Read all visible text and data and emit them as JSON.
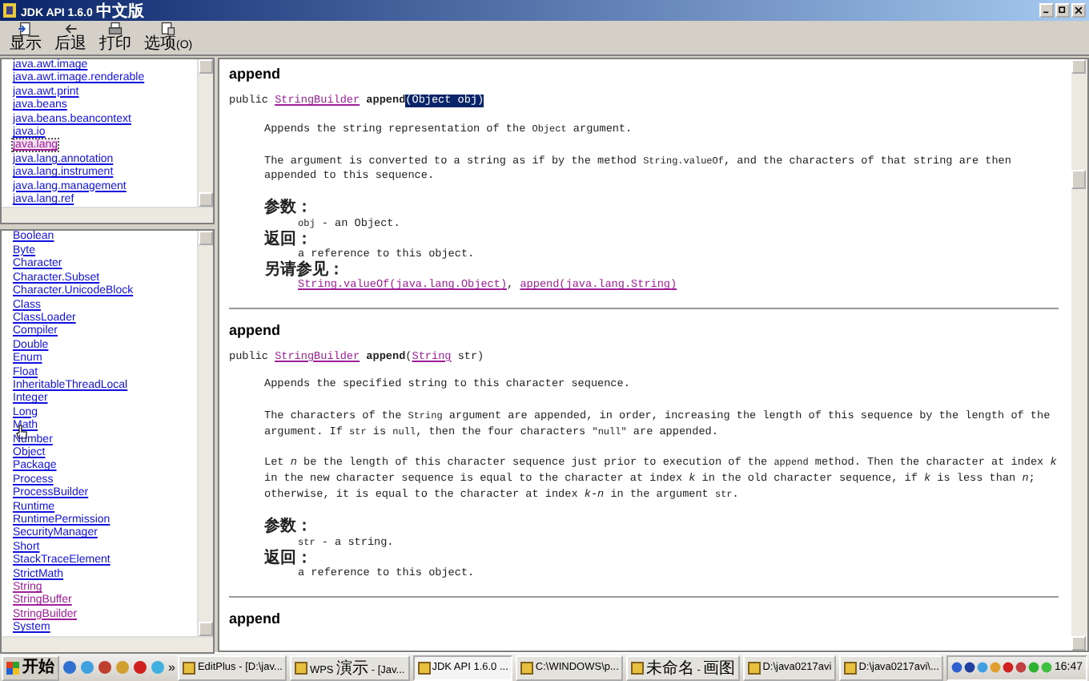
{
  "window": {
    "title": "JDK API 1.6.0 中文版"
  },
  "toolbar": [
    {
      "label": "显示"
    },
    {
      "label": "后退"
    },
    {
      "label": "打印"
    },
    {
      "label": "选项(O)"
    }
  ],
  "packages": [
    {
      "label": "java.awt.image",
      "selected": false,
      "visited": false
    },
    {
      "label": "java.awt.image.renderable",
      "selected": false,
      "visited": false
    },
    {
      "label": "java.awt.print",
      "selected": false,
      "visited": false
    },
    {
      "label": "java.beans",
      "selected": false,
      "visited": false
    },
    {
      "label": "java.beans.beancontext",
      "selected": false,
      "visited": false
    },
    {
      "label": "java.io",
      "selected": false,
      "visited": false
    },
    {
      "label": "java.lang",
      "selected": true,
      "visited": true
    },
    {
      "label": "java.lang.annotation",
      "selected": false,
      "visited": false
    },
    {
      "label": "java.lang.instrument",
      "selected": false,
      "visited": false
    },
    {
      "label": "java.lang.management",
      "selected": false,
      "visited": false
    },
    {
      "label": "java.lang.ref",
      "selected": false,
      "visited": false
    }
  ],
  "classes": [
    {
      "label": "Boolean",
      "visited": false,
      "hovered": false
    },
    {
      "label": "Byte",
      "visited": false,
      "hovered": false
    },
    {
      "label": "Character",
      "visited": false,
      "hovered": false
    },
    {
      "label": "Character.Subset",
      "visited": false,
      "hovered": false
    },
    {
      "label": "Character.UnicodeBlock",
      "visited": false,
      "hovered": false
    },
    {
      "label": "Class",
      "visited": false,
      "hovered": false
    },
    {
      "label": "ClassLoader",
      "visited": false,
      "hovered": false
    },
    {
      "label": "Compiler",
      "visited": false,
      "hovered": false
    },
    {
      "label": "Double",
      "visited": false,
      "hovered": false
    },
    {
      "label": "Enum",
      "visited": false,
      "hovered": false
    },
    {
      "label": "Float",
      "visited": false,
      "hovered": false
    },
    {
      "label": "InheritableThreadLocal",
      "visited": false,
      "hovered": false
    },
    {
      "label": "Integer",
      "visited": false,
      "hovered": false
    },
    {
      "label": "Long",
      "visited": false,
      "hovered": false
    },
    {
      "label": "Math",
      "visited": false,
      "hovered": true
    },
    {
      "label": "Number",
      "visited": false,
      "hovered": false
    },
    {
      "label": "Object",
      "visited": false,
      "hovered": false
    },
    {
      "label": "Package",
      "visited": false,
      "hovered": false
    },
    {
      "label": "Process",
      "visited": false,
      "hovered": false
    },
    {
      "label": "ProcessBuilder",
      "visited": false,
      "hovered": false
    },
    {
      "label": "Runtime",
      "visited": false,
      "hovered": false
    },
    {
      "label": "RuntimePermission",
      "visited": false,
      "hovered": false
    },
    {
      "label": "SecurityManager",
      "visited": false,
      "hovered": false
    },
    {
      "label": "Short",
      "visited": false,
      "hovered": false
    },
    {
      "label": "StackTraceElement",
      "visited": false,
      "hovered": false
    },
    {
      "label": "StrictMath",
      "visited": false,
      "hovered": false
    },
    {
      "label": "String",
      "visited": true,
      "hovered": false
    },
    {
      "label": "StringBuffer",
      "visited": true,
      "hovered": false
    },
    {
      "label": "StringBuilder",
      "visited": true,
      "hovered": false
    },
    {
      "label": "System",
      "visited": false,
      "hovered": false
    }
  ],
  "methods": [
    {
      "title": "append",
      "signature": [
        {
          "kind": "text",
          "text": "public "
        },
        {
          "kind": "link",
          "text": "StringBuilder"
        },
        {
          "kind": "bold",
          "text": "append"
        },
        {
          "kind": "selected",
          "text": "(Object obj)"
        }
      ],
      "paragraphs": [
        [
          {
            "kind": "text",
            "text": "Appends the string representation of the "
          },
          {
            "kind": "code",
            "text": "Object"
          },
          {
            "kind": "text",
            "text": " argument."
          }
        ],
        [
          {
            "kind": "text",
            "text": "The argument is converted to a string as if by the method "
          },
          {
            "kind": "code",
            "text": "String.valueOf"
          },
          {
            "kind": "text",
            "text": ", and the characters of that string are then appended to this sequence."
          }
        ]
      ],
      "tags": [
        {
          "heading": "参数：",
          "lines": [
            [
              {
                "kind": "code",
                "text": "obj"
              },
              {
                "kind": "text",
                "text": " - an Object."
              }
            ]
          ]
        },
        {
          "heading": "返回：",
          "lines": [
            [
              {
                "kind": "text",
                "text": "a reference to this object."
              }
            ]
          ]
        },
        {
          "heading": "另请参见：",
          "lines": [
            [
              {
                "kind": "link",
                "text": "String.valueOf(java.lang.Object)"
              },
              {
                "kind": "text",
                "text": ", "
              },
              {
                "kind": "link",
                "text": "append(java.lang.String)"
              }
            ]
          ]
        }
      ]
    },
    {
      "title": "append",
      "signature": [
        {
          "kind": "text",
          "text": "public "
        },
        {
          "kind": "link",
          "text": "StringBuilder"
        },
        {
          "kind": "bold",
          "text": "append"
        },
        {
          "kind": "text",
          "text": "("
        },
        {
          "kind": "link",
          "text": "String"
        },
        {
          "kind": "text",
          "text": " str)"
        }
      ],
      "paragraphs": [
        [
          {
            "kind": "text",
            "text": "Appends the specified string to this character sequence."
          }
        ],
        [
          {
            "kind": "text",
            "text": "The characters of the "
          },
          {
            "kind": "code",
            "text": "String"
          },
          {
            "kind": "text",
            "text": " argument are appended, in order, increasing the length of this sequence by the length of the argument. If "
          },
          {
            "kind": "code",
            "text": "str"
          },
          {
            "kind": "text",
            "text": " is "
          },
          {
            "kind": "code",
            "text": "null"
          },
          {
            "kind": "text",
            "text": ", then the four characters "
          },
          {
            "kind": "code",
            "text": "\"null\""
          },
          {
            "kind": "text",
            "text": " are appended."
          }
        ],
        [
          {
            "kind": "text",
            "text": "Let "
          },
          {
            "kind": "italic",
            "text": "n"
          },
          {
            "kind": "text",
            "text": " be the length of this character sequence just prior to execution of the "
          },
          {
            "kind": "code",
            "text": "append"
          },
          {
            "kind": "text",
            "text": " method. Then the character at index "
          },
          {
            "kind": "italic",
            "text": "k"
          },
          {
            "kind": "text",
            "text": " in the new character sequence is equal to the character at index "
          },
          {
            "kind": "italic",
            "text": "k"
          },
          {
            "kind": "text",
            "text": " in the old character sequence, if "
          },
          {
            "kind": "italic",
            "text": "k"
          },
          {
            "kind": "text",
            "text": " is less than "
          },
          {
            "kind": "italic",
            "text": "n"
          },
          {
            "kind": "text",
            "text": "; otherwise, it is equal to the character at index "
          },
          {
            "kind": "italic",
            "text": "k-n"
          },
          {
            "kind": "text",
            "text": " in the argument "
          },
          {
            "kind": "code",
            "text": "str"
          },
          {
            "kind": "text",
            "text": "."
          }
        ]
      ],
      "tags": [
        {
          "heading": "参数：",
          "lines": [
            [
              {
                "kind": "code",
                "text": "str"
              },
              {
                "kind": "text",
                "text": " - a string."
              }
            ]
          ]
        },
        {
          "heading": "返回：",
          "lines": [
            [
              {
                "kind": "text",
                "text": "a reference to this object."
              }
            ]
          ]
        }
      ]
    },
    {
      "title": "append"
    }
  ],
  "taskbar": {
    "start": "开始",
    "chevron": "»",
    "tasks": [
      {
        "label": "EditPlus - [D:\\jav...",
        "selected": false
      },
      {
        "label": "WPS 演示 - [Jav...",
        "selected": false
      },
      {
        "label": "JDK API 1.6.0 ...",
        "selected": true
      },
      {
        "label": "C:\\WINDOWS\\p...",
        "selected": false
      },
      {
        "label": "未命名 - 画图",
        "selected": false
      },
      {
        "label": "D:\\java0217avi",
        "selected": false
      },
      {
        "label": "D:\\java0217avi\\...",
        "selected": false
      }
    ],
    "clock": "16:47"
  }
}
